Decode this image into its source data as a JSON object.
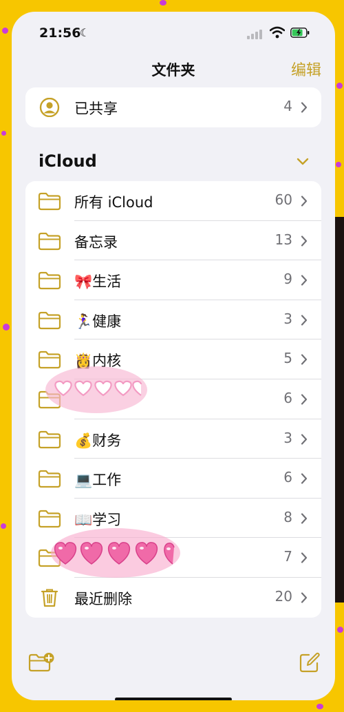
{
  "status_bar": {
    "time": "21:56"
  },
  "nav": {
    "title": "文件夹",
    "edit_label": "编辑"
  },
  "shared": {
    "label": "已共享",
    "count": "4"
  },
  "section": {
    "title": "iCloud"
  },
  "folders": [
    {
      "label": "所有 iCloud",
      "count": "60",
      "icon": "folder-icon"
    },
    {
      "label": "备忘录",
      "count": "13",
      "icon": "folder-icon"
    },
    {
      "label": "🎀生活",
      "count": "9",
      "icon": "folder-icon"
    },
    {
      "label": "🏃‍♀️健康",
      "count": "3",
      "icon": "folder-icon"
    },
    {
      "label": "👸内核",
      "count": "5",
      "icon": "folder-icon"
    },
    {
      "label": "",
      "count": "6",
      "icon": "folder-icon"
    },
    {
      "label": "💰财务",
      "count": "3",
      "icon": "folder-icon"
    },
    {
      "label": "💻工作",
      "count": "6",
      "icon": "folder-icon"
    },
    {
      "label": "📖学习",
      "count": "8",
      "icon": "folder-icon"
    },
    {
      "label": "",
      "count": "7",
      "icon": "folder-icon"
    },
    {
      "label": "最近删除",
      "count": "20",
      "icon": "trash-icon"
    }
  ],
  "colors": {
    "accent": "#c5a127",
    "background": "#f1f1f6",
    "card": "#ffffff",
    "count": "#707075",
    "sticker_pink": "#f06aa8"
  }
}
